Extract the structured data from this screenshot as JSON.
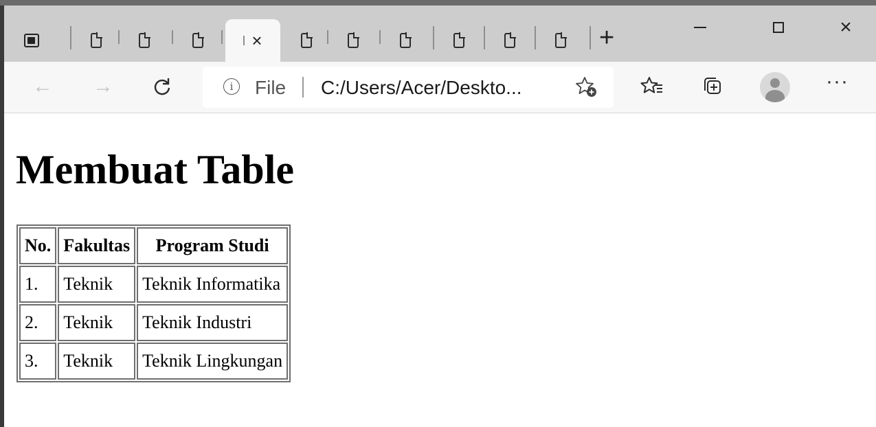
{
  "browser": {
    "tabs": [
      {
        "icon": "document-icon"
      },
      {
        "icon": "document-icon"
      },
      {
        "icon": "document-icon"
      },
      {
        "icon": "close-icon",
        "active": true
      },
      {
        "icon": "document-icon"
      },
      {
        "icon": "document-icon"
      },
      {
        "icon": "document-icon"
      },
      {
        "icon": "document-icon"
      },
      {
        "icon": "document-icon"
      },
      {
        "icon": "document-icon"
      }
    ],
    "new_tab_glyph": "+",
    "window_controls": {
      "minimize": "minimize-icon",
      "maximize": "maximize-icon",
      "close": "×"
    },
    "address_bar": {
      "scheme_label": "File",
      "url": "C:/Users/Acer/Deskto..."
    },
    "toolbar_icons": [
      "favorites-icon",
      "collections-icon",
      "profile-avatar",
      "more-icon"
    ]
  },
  "page": {
    "heading": "Membuat Table",
    "table": {
      "headers": [
        "No.",
        "Fakultas",
        "Program Studi"
      ],
      "rows": [
        [
          "1.",
          "Teknik",
          "Teknik Informatika"
        ],
        [
          "2.",
          "Teknik",
          "Teknik Industri"
        ],
        [
          "3.",
          "Teknik",
          "Teknik Lingkungan"
        ]
      ]
    }
  }
}
